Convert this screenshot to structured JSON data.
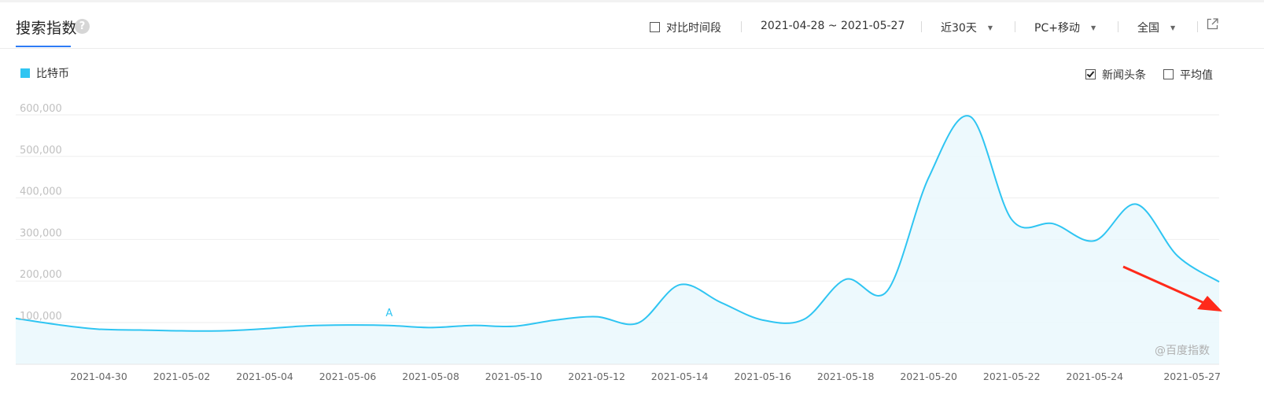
{
  "header": {
    "title": "搜索指数",
    "help_icon": "question-icon",
    "compare_label": "对比时间段",
    "date_range": "2021-04-28 ~ 2021-05-27",
    "period_select": "近30天",
    "device_select": "PC+移动",
    "region_select": "全国",
    "export_icon": "external-link-icon"
  },
  "legend": {
    "series_name": "比特币",
    "color": "#2fc5f2"
  },
  "options": {
    "news_label": "新闻头条",
    "news_checked": true,
    "avg_label": "平均值",
    "avg_checked": false
  },
  "annotation": {
    "label": "A",
    "date": "2021-05-07"
  },
  "watermark": "@百度指数",
  "chart_data": {
    "type": "area",
    "y_ticks": [
      "100,000",
      "200,000",
      "300,000",
      "400,000",
      "500,000",
      "600,000"
    ],
    "x_ticks": [
      "2021-04-30",
      "2021-05-02",
      "2021-05-04",
      "2021-05-06",
      "2021-05-08",
      "2021-05-10",
      "2021-05-12",
      "2021-05-14",
      "2021-05-16",
      "2021-05-18",
      "2021-05-20",
      "2021-05-22",
      "2021-05-24",
      "2021-05-27"
    ],
    "ylim": [
      0,
      600000
    ],
    "grid": true,
    "x": [
      "2021-04-28",
      "2021-04-29",
      "2021-04-30",
      "2021-05-01",
      "2021-05-02",
      "2021-05-03",
      "2021-05-04",
      "2021-05-05",
      "2021-05-06",
      "2021-05-07",
      "2021-05-08",
      "2021-05-09",
      "2021-05-10",
      "2021-05-11",
      "2021-05-12",
      "2021-05-13",
      "2021-05-14",
      "2021-05-15",
      "2021-05-16",
      "2021-05-17",
      "2021-05-18",
      "2021-05-19",
      "2021-05-20",
      "2021-05-21",
      "2021-05-22",
      "2021-05-23",
      "2021-05-24",
      "2021-05-25",
      "2021-05-26",
      "2021-05-27"
    ],
    "series": [
      {
        "name": "比特币",
        "color": "#2fc5f2",
        "values": [
          110000,
          95000,
          84000,
          82000,
          80000,
          80000,
          85000,
          92000,
          94000,
          93000,
          88000,
          93000,
          91000,
          106000,
          114000,
          99000,
          191000,
          148000,
          106000,
          108000,
          204000,
          176000,
          449000,
          596000,
          348000,
          338000,
          297000,
          385000,
          260000,
          198000
        ]
      }
    ]
  },
  "arrow_color": "#ff2a1a"
}
